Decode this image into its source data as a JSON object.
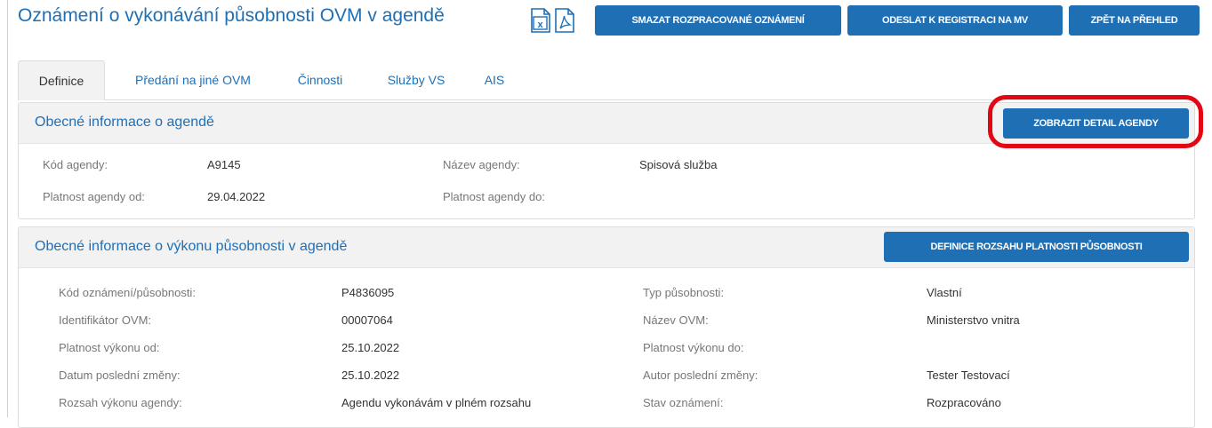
{
  "header": {
    "title": "Oznámení o vykonávání působnosti OVM v agendě",
    "icons": [
      "excel-icon",
      "pdf-icon"
    ],
    "buttons": {
      "delete": "SMAZAT ROZPRACOVANÉ OZNÁMENÍ",
      "send": "ODESLAT K REGISTRACI NA MV",
      "back": "ZPĚT NA PŘEHLED"
    }
  },
  "tabs": [
    {
      "label": "Definice",
      "active": true
    },
    {
      "label": "Předání na jiné OVM",
      "active": false
    },
    {
      "label": "Činnosti",
      "active": false
    },
    {
      "label": "Služby VS",
      "active": false
    },
    {
      "label": "AIS",
      "active": false
    }
  ],
  "agenda_panel": {
    "title": "Obecné informace o agendě",
    "button": "ZOBRAZIT DETAIL AGENDY",
    "fields": {
      "kod_label": "Kód agendy:",
      "kod_value": "A9145",
      "nazev_label": "Název agendy:",
      "nazev_value": "Spisová služba",
      "platnost_od_label": "Platnost agendy od:",
      "platnost_od_value": "29.04.2022",
      "platnost_do_label": "Platnost agendy do:",
      "platnost_do_value": ""
    }
  },
  "vykon_panel": {
    "title": "Obecné informace o výkonu působnosti v agendě",
    "button": "DEFINICE ROZSAHU PLATNOSTI PŮSOBNOSTI",
    "rows": [
      {
        "l1": "Kód oznámení/působnosti:",
        "v1": "P4836095",
        "l2": "Typ působnosti:",
        "v2": "Vlastní"
      },
      {
        "l1": "Identifikátor OVM:",
        "v1": "00007064",
        "l2": "Název OVM:",
        "v2": "Ministerstvo vnitra"
      },
      {
        "l1": "Platnost výkonu od:",
        "v1": "25.10.2022",
        "l2": "Platnost výkonu do:",
        "v2": ""
      },
      {
        "l1": "Datum poslední změny:",
        "v1": "25.10.2022",
        "l2": "Autor poslední změny:",
        "v2": "Tester Testovací"
      },
      {
        "l1": "Rozsah výkonu agendy:",
        "v1": "Agendu vykonávám v plném rozsahu",
        "l2": "Stav oznámení:",
        "v2": "Rozpracováno"
      }
    ]
  },
  "colors": {
    "accent": "#1f6fb5",
    "highlight": "#e30613",
    "panel_header": "#f2f2f2"
  }
}
